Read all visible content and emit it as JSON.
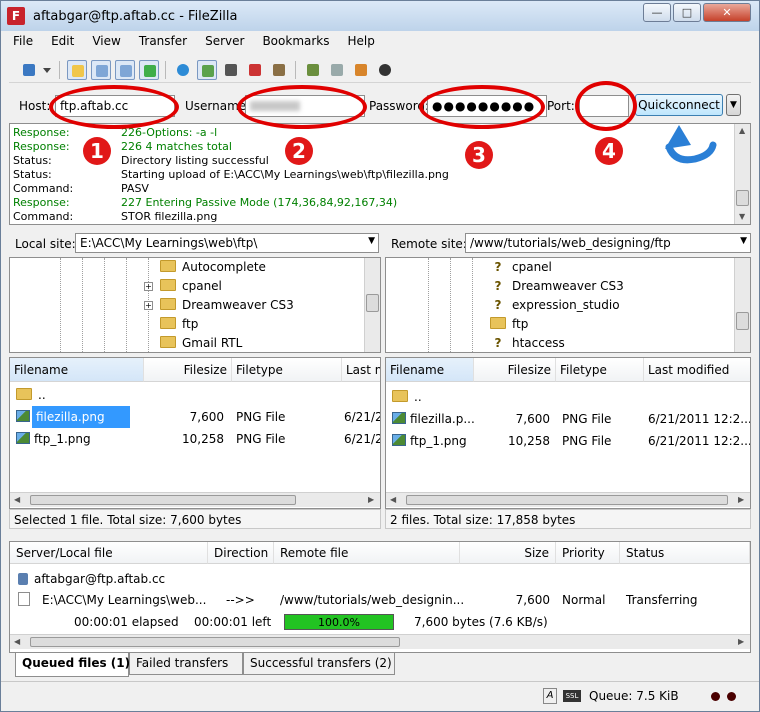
{
  "window": {
    "title": "aftabgar@ftp.aftab.cc - FileZilla",
    "app_icon_letter": "F"
  },
  "menu": [
    "File",
    "Edit",
    "View",
    "Transfer",
    "Server",
    "Bookmarks",
    "Help"
  ],
  "quickconnect": {
    "host_label": "Host:",
    "host_value": "ftp.aftab.cc",
    "username_label": "Username:",
    "password_label": "Password:",
    "password_value": "●●●●●●●●●",
    "port_label": "Port:",
    "port_value": "",
    "button_label": "Quickconnect"
  },
  "annotations": [
    "1",
    "2",
    "3",
    "4"
  ],
  "log": [
    {
      "label": "Response:",
      "msg": "226-Options: -a -l",
      "color": "green"
    },
    {
      "label": "Response:",
      "msg": "226 4 matches total",
      "color": "green"
    },
    {
      "label": "Status:",
      "msg": "Directory listing successful",
      "color": "black"
    },
    {
      "label": "Status:",
      "msg": "Starting upload of E:\\ACC\\My Learnings\\web\\ftp\\filezilla.png",
      "color": "black"
    },
    {
      "label": "Command:",
      "msg": "PASV",
      "color": "black"
    },
    {
      "label": "Response:",
      "msg": "227 Entering Passive Mode (174,36,84,92,167,34)",
      "color": "green"
    },
    {
      "label": "Command:",
      "msg": "STOR filezilla.png",
      "color": "black"
    }
  ],
  "local": {
    "site_label": "Local site:",
    "site_path": "E:\\ACC\\My Learnings\\web\\ftp\\",
    "tree": [
      "Autocomplete",
      "cpanel",
      "Dreamweaver CS3",
      "ftp",
      "Gmail RTL"
    ],
    "columns": [
      "Filename",
      "Filesize",
      "Filetype",
      "Last m"
    ],
    "files": [
      {
        "name": "..",
        "size": "",
        "type": "",
        "modified": ""
      },
      {
        "name": "filezilla.png",
        "size": "7,600",
        "type": "PNG File",
        "modified": "6/21/2"
      },
      {
        "name": "ftp_1.png",
        "size": "10,258",
        "type": "PNG File",
        "modified": "6/21/2"
      }
    ],
    "status": "Selected 1 file. Total size: 7,600 bytes"
  },
  "remote": {
    "site_label": "Remote site:",
    "site_path": "/www/tutorials/web_designing/ftp",
    "tree": [
      "cpanel",
      "Dreamweaver CS3",
      "expression_studio",
      "ftp",
      "htaccess"
    ],
    "columns": [
      "Filename",
      "Filesize",
      "Filetype",
      "Last modified"
    ],
    "files": [
      {
        "name": "..",
        "size": "",
        "type": "",
        "modified": ""
      },
      {
        "name": "filezilla.p...",
        "size": "7,600",
        "type": "PNG File",
        "modified": "6/21/2011 12:2..."
      },
      {
        "name": "ftp_1.png",
        "size": "10,258",
        "type": "PNG File",
        "modified": "6/21/2011 12:2..."
      }
    ],
    "status": "2 files. Total size: 17,858 bytes"
  },
  "queue": {
    "columns": [
      "Server/Local file",
      "Direction",
      "Remote file",
      "Size",
      "Priority",
      "Status"
    ],
    "server": "aftabgar@ftp.aftab.cc",
    "item": {
      "local": "E:\\ACC\\My Learnings\\web...",
      "direction": "-->>",
      "remote": "/www/tutorials/web_designin...",
      "size": "7,600",
      "priority": "Normal",
      "status": "Transferring"
    },
    "elapsed": "00:00:01 elapsed",
    "left": "00:00:01 left",
    "progress": 1.0,
    "progress_text": "100.0%",
    "bytes": "7,600 bytes (7.6 KB/s)"
  },
  "tabs": [
    "Queued files (1)",
    "Failed transfers",
    "Successful transfers (2)"
  ],
  "statusbar": {
    "queue": "Queue: 7.5 KiB"
  },
  "colors": {
    "annotation": "#e00000",
    "selection": "#3399ff",
    "progress": "#22c322",
    "log_green": "#008000"
  }
}
